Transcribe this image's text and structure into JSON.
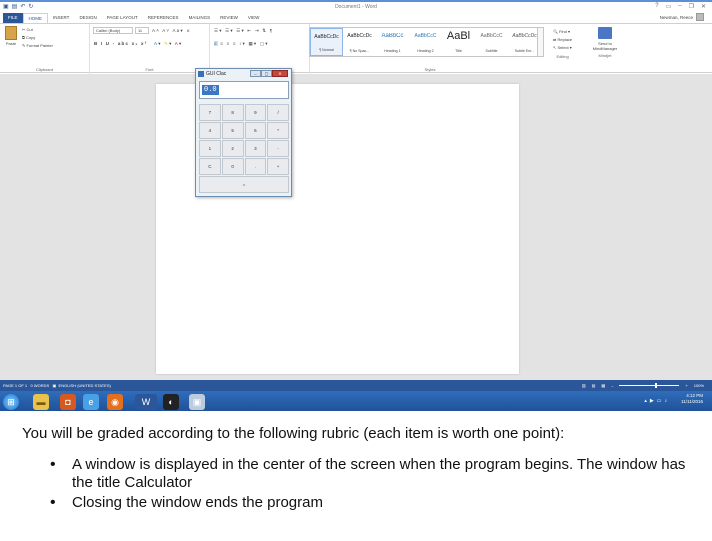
{
  "word": {
    "title": "Document1 - Word",
    "tabs": [
      "FILE",
      "HOME",
      "INSERT",
      "DESIGN",
      "PAGE LAYOUT",
      "REFERENCES",
      "MAILINGS",
      "REVIEW",
      "VIEW"
    ],
    "user": "Newman, Reece",
    "help": "?",
    "clipboard": {
      "paste": "Paste",
      "cut": "Cut",
      "copy": "Copy",
      "format_painter": "Format Painter",
      "label": "Clipboard"
    },
    "font": {
      "name": "Calibri (Body)",
      "size": "11",
      "label": "Font"
    },
    "paragraph_label": "Paragraph",
    "styles": [
      {
        "preview": "AaBbCcDc",
        "name": "¶ Normal"
      },
      {
        "preview": "AaBbCcDc",
        "name": "¶ No Spac..."
      },
      {
        "preview": "AaBbCc",
        "name": "Heading 1"
      },
      {
        "preview": "AaBbCcC",
        "name": "Heading 2"
      },
      {
        "preview": "AaBl",
        "name": "Title"
      },
      {
        "preview": "AaBbCcC",
        "name": "Subtitle"
      },
      {
        "preview": "AaBbCcDc",
        "name": "Subtle Em..."
      }
    ],
    "styles_label": "Styles",
    "editing": {
      "find": "Find",
      "replace": "Replace",
      "select": "Select",
      "label": "Editing"
    },
    "mindmanager": {
      "send": "Send to MindManager",
      "label": "Mindjet"
    },
    "status": {
      "page": "PAGE 1 OF 1",
      "words": "0 WORDS",
      "language": "ENGLISH (UNITED STATES)",
      "zoom": "100%"
    },
    "zoom_fraction": 0.6
  },
  "calculator": {
    "title": "GUI Clac",
    "display": "0.0",
    "keys": [
      "7",
      "8",
      "9",
      "/",
      "4",
      "5",
      "6",
      "*",
      "1",
      "2",
      "3",
      "-",
      "C",
      "0",
      ".",
      "+",
      "="
    ]
  },
  "taskbar": {
    "time": "4:12 PM",
    "date": "11/11/2016"
  },
  "assignment": {
    "intro": "You will be graded according to the following rubric (each item is worth one point):",
    "rubric": [
      "A window is displayed in the center of the screen when the program begins. The window has the title Calculator",
      "Closing the window ends the program"
    ]
  }
}
